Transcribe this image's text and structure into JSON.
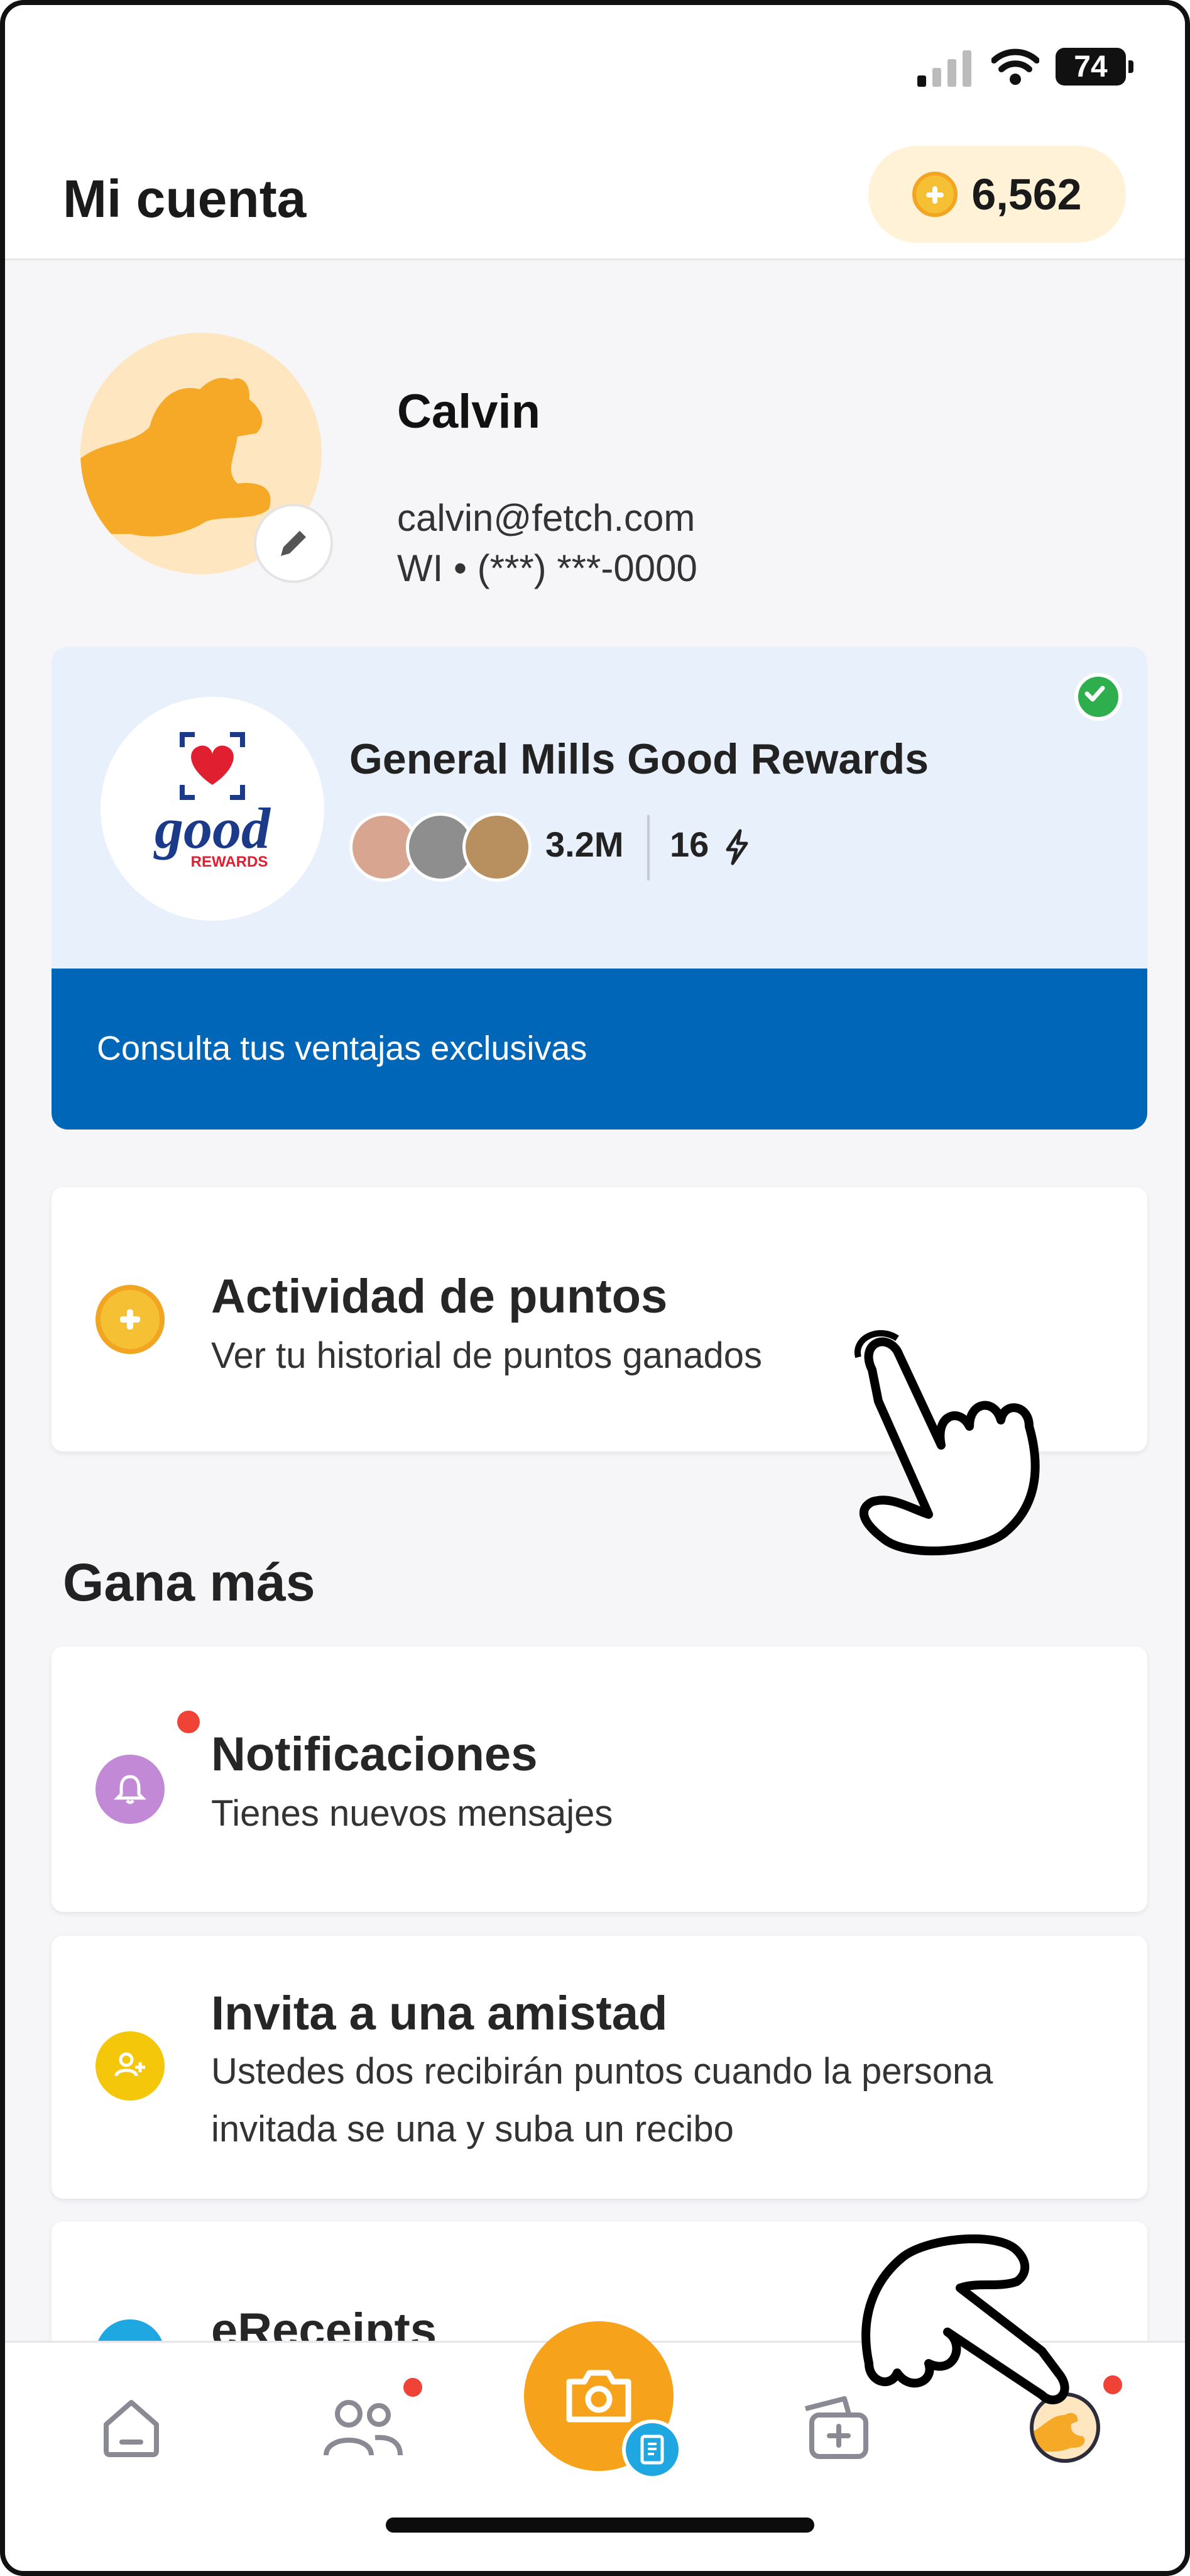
{
  "status_bar": {
    "battery": "74"
  },
  "header": {
    "title": "Mi cuenta",
    "points": "6,562"
  },
  "profile": {
    "name": "Calvin",
    "email": "calvin@fetch.com",
    "phone": "WI • (***) ***-0000"
  },
  "featured": {
    "name": "General Mills Good Rewards",
    "members": "3.2M",
    "streak": "16",
    "link": "Consulta tus ventajas exclusivas",
    "logo_text": "good",
    "logo_sub": "REWARDS"
  },
  "points_activity": {
    "title": "Actividad de puntos",
    "subtitle": "Ver tu historial de puntos ganados"
  },
  "section_title": "Gana más",
  "earn_items": [
    {
      "title": "Notificaciones",
      "subtitle": "Tienes nuevos mensajes"
    },
    {
      "title": "Invita a una amistad",
      "subtitle": "Ustedes dos recibirán puntos cuando la persona invitada se una y suba un recibo"
    },
    {
      "title": "eReceipts"
    }
  ],
  "bottom_nav": [
    "home-icon",
    "friends-icon",
    "camera-icon",
    "rewards-icon",
    "profile-icon"
  ],
  "colors": {
    "accent": "#f7a21b",
    "brand_blue": "#0067b8",
    "notification_dot": "#f04337"
  }
}
